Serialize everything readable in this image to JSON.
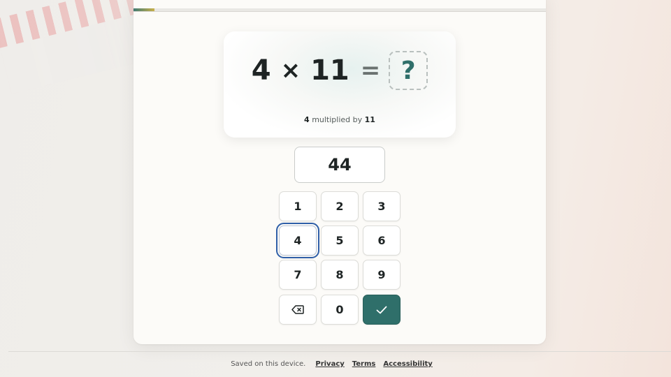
{
  "progress": {
    "fraction": 0.05,
    "colors": [
      "#3f7a72",
      "#c9b04a"
    ]
  },
  "question": {
    "a": "4",
    "op": "×",
    "b": "11",
    "eq": "=",
    "placeholder": "?",
    "caption_a": "4",
    "caption_mid": "multiplied by",
    "caption_b": "11"
  },
  "answer": {
    "value": "44"
  },
  "keypad": {
    "keys": [
      "1",
      "2",
      "3",
      "4",
      "5",
      "6",
      "7",
      "8",
      "9",
      "",
      "0",
      ""
    ],
    "focused_key": "4",
    "backspace_icon": "backspace-icon",
    "submit_icon": "check-icon"
  },
  "footer": {
    "saved": "Saved on this device.",
    "privacy": "Privacy",
    "terms": "Terms",
    "accessibility": "Accessibility"
  },
  "colors": {
    "accent": "#2f6f6a",
    "focus": "#2f5fa8"
  }
}
